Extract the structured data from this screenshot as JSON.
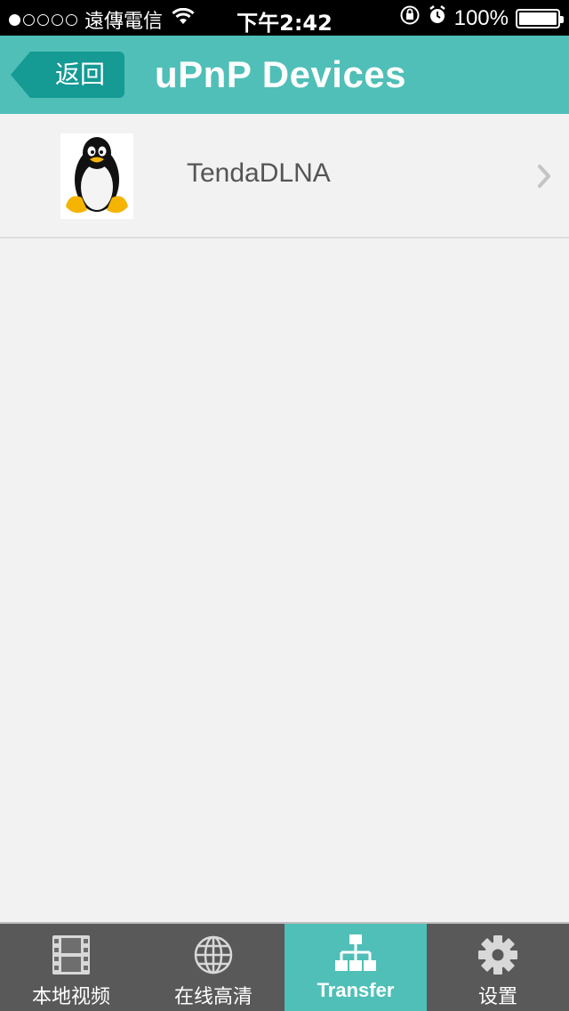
{
  "status_bar": {
    "signal_dots_filled": 1,
    "signal_dots_total": 5,
    "carrier": "遠傳電信",
    "time": "下午2:42",
    "battery": "100%",
    "battery_level": 1.0,
    "icons": [
      "wifi-icon",
      "orientation-lock-icon",
      "alarm-icon",
      "battery-icon"
    ]
  },
  "nav": {
    "back_label": "返回",
    "title": "uPnP Devices",
    "color": "#4fbfb8",
    "back_color": "#159a94"
  },
  "devices": [
    {
      "name": "TendaDLNA",
      "icon": "linux-penguin-icon"
    }
  ],
  "tabs": [
    {
      "label": "本地视频",
      "icon": "film-icon",
      "active": false
    },
    {
      "label": "在线高清",
      "icon": "globe-icon",
      "active": false
    },
    {
      "label": "Transfer",
      "icon": "network-icon",
      "active": true
    },
    {
      "label": "设置",
      "icon": "gear-icon",
      "active": false
    }
  ]
}
